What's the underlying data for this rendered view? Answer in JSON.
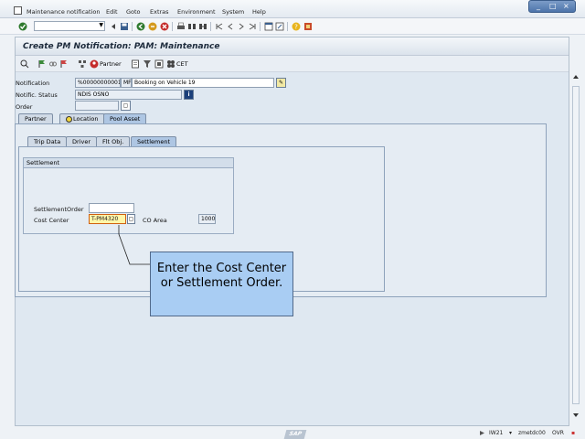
{
  "menu": {
    "items": [
      "Maintenance notification",
      "Edit",
      "Goto",
      "Extras",
      "Environment",
      "System",
      "Help"
    ]
  },
  "window_controls": [
    "_",
    "□",
    "×"
  ],
  "title": "Create PM Notification: PAM: Maintenance",
  "app_toolbar": {
    "partner_label": "Partner",
    "cet_label": "CET"
  },
  "form": {
    "notification_label": "Notification",
    "notification_number": "%00000000001",
    "notification_type": "MF",
    "notification_desc": "Booking on Vehicle 19",
    "status_label": "Notific. Status",
    "status_value": "NDIS OSNO",
    "order_label": "Order",
    "order_value": ""
  },
  "tabs": [
    {
      "label": "Partner"
    },
    {
      "label": "Location"
    },
    {
      "label": "Pool Asset"
    }
  ],
  "subtabs": [
    {
      "label": "Trip Data"
    },
    {
      "label": "Driver"
    },
    {
      "label": "Flt Obj."
    },
    {
      "label": "Settlement"
    }
  ],
  "settlement": {
    "group_title": "Settlement",
    "settlement_order_label": "SettlementOrder",
    "settlement_order_value": "",
    "cost_center_label": "Cost Center",
    "cost_center_value": "T-PM4320",
    "co_area_label": "CO Area",
    "co_area_value": "1000"
  },
  "callout": {
    "text": "Enter the Cost Center or Settlement Order."
  },
  "status_bar": {
    "sap": "SAP",
    "transaction": "IW21",
    "server": "zmetdc00",
    "mode": "OVR"
  },
  "colors": {
    "callout_bg": "#a9cdf3",
    "active_tab": "#aec6e3",
    "frame_bg": "#dfe8f1"
  }
}
